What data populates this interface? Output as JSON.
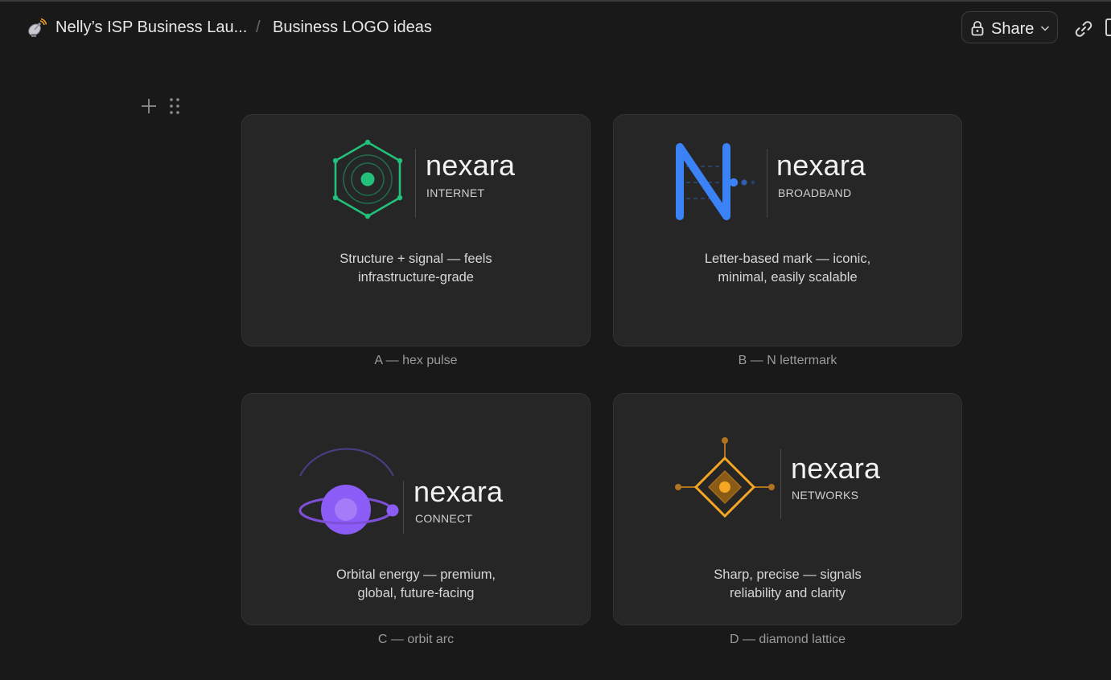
{
  "header": {
    "workspace_title": "Nelly’s ISP Business Lau...",
    "separator": "/",
    "page_title": "Business LOGO ideas",
    "share_label": "Share"
  },
  "cards": [
    {
      "brand": "nexara",
      "tagline": "INTERNET",
      "description_line1": "Structure + signal — feels",
      "description_line2": "infrastructure-grade",
      "caption": "A — hex pulse",
      "accent": "#22c07a"
    },
    {
      "brand": "nexara",
      "tagline": "BROADBAND",
      "description_line1": "Letter-based mark — iconic,",
      "description_line2": "minimal, easily scalable",
      "caption": "B — N lettermark",
      "accent": "#3b82f6"
    },
    {
      "brand": "nexara",
      "tagline": "CONNECT",
      "description_line1": "Orbital energy — premium,",
      "description_line2": "global, future-facing",
      "caption": "C — orbit arc",
      "accent": "#8b5cf6"
    },
    {
      "brand": "nexara",
      "tagline": "NETWORKS",
      "description_line1": "Sharp, precise — signals",
      "description_line2": "reliability and clarity",
      "caption": "D — diamond lattice",
      "accent": "#f59e0b"
    }
  ],
  "icons": [
    "satellite-dish-icon",
    "lock-icon",
    "chevron-down-icon",
    "link-icon",
    "plus-icon",
    "drag-handle-icon"
  ]
}
